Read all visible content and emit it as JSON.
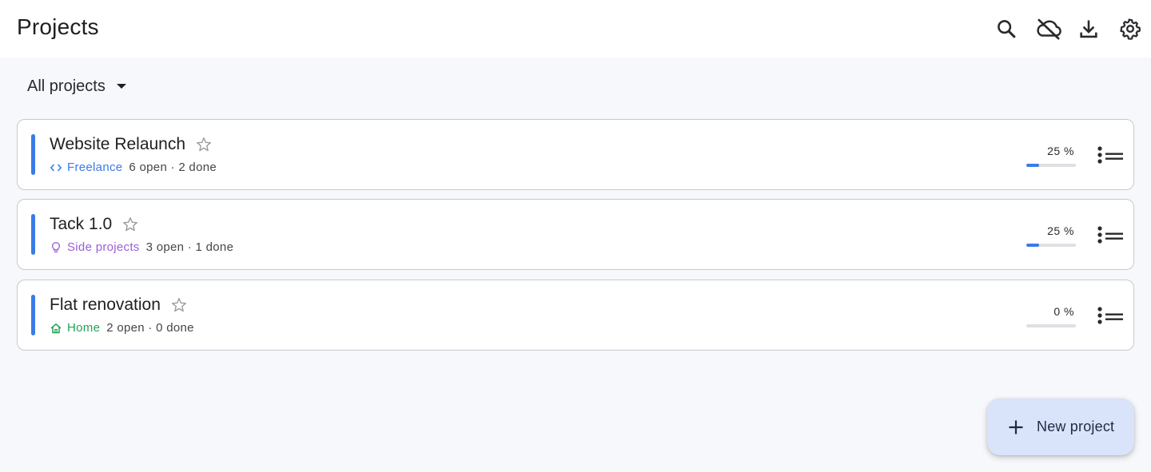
{
  "header": {
    "title": "Projects",
    "icons": [
      "search-icon",
      "cloud-off-icon",
      "download-icon",
      "settings-icon"
    ]
  },
  "filter": {
    "label": "All projects"
  },
  "colors": {
    "accent": "#3b7be8",
    "freelance": "#3b7be8",
    "side_projects": "#9a5fd6",
    "home": "#22a454"
  },
  "projects": [
    {
      "title": "Website Relaunch",
      "category": "Freelance",
      "category_icon": "code-icon",
      "counts": "6 open · 2 done",
      "progress_label": "25 %",
      "progress": 0.25
    },
    {
      "title": "Tack 1.0",
      "category": "Side projects",
      "category_icon": "lightbulb-icon",
      "counts": "3 open · 1 done",
      "progress_label": "25 %",
      "progress": 0.25
    },
    {
      "title": "Flat renovation",
      "category": "Home",
      "category_icon": "home-icon",
      "counts": "2 open · 0 done",
      "progress_label": "0 %",
      "progress": 0
    }
  ],
  "fab": {
    "label": "New project"
  }
}
